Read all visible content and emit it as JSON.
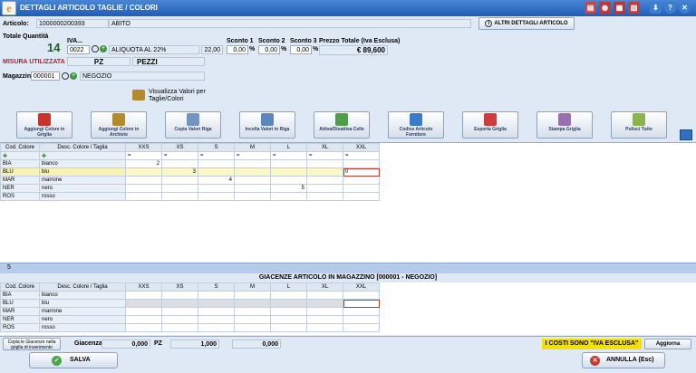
{
  "window": {
    "title": "DETTAGLI ARTICOLO TAGLIE / COLORI",
    "app_icon": "e",
    "controls": [
      "pdf-icon",
      "camera-icon",
      "calendar-icon",
      "calculator-icon",
      "download-icon",
      "help-icon",
      "close-icon"
    ]
  },
  "articolo": {
    "label": "Articolo:",
    "code": "1000000200393",
    "desc": "ABITO",
    "more_details": "ALTRI DETTAGLI ARTICOLO"
  },
  "quantita": {
    "label": "Totale Quantità",
    "value": "14"
  },
  "iva": {
    "label": "IVA...",
    "code": "0022",
    "desc": "ALIQUOTA AL 22%",
    "rate": "22,00"
  },
  "sconti": [
    {
      "label": "Sconto 1",
      "value": "0,00",
      "pct": "%"
    },
    {
      "label": "Sconto 2",
      "value": "0,00",
      "pct": "%"
    },
    {
      "label": "Sconto 3",
      "value": "0,00",
      "pct": "%"
    }
  ],
  "prezzo": {
    "label": "Prezzo Totale (Iva Esclusa)",
    "value": "€ 89,600"
  },
  "misura": {
    "label": "MISURA UTILIZZATA :",
    "code": "PZ",
    "desc": "PEZZI"
  },
  "magazzino": {
    "label": "Magazzino",
    "code": "000001",
    "desc": "NEGOZIO"
  },
  "visualizza": "Visualizza Valori per Taglie/Colori",
  "toolbar": [
    {
      "name": "aggiungi-colore-griglia",
      "label": "Aggiungi Colore in Griglia",
      "icon": "#c9332b"
    },
    {
      "name": "aggiungi-colore-archivio",
      "label": "Aggiungi Colore in Archivio",
      "icon": "#b58a2c"
    },
    {
      "name": "copia-valori-riga",
      "label": "Copia Valori Riga",
      "icon": "#6f95c4"
    },
    {
      "name": "incolla-valori-riga",
      "label": "Incolla Valori in Riga",
      "icon": "#5d86bd"
    },
    {
      "name": "attiva-disattiva-celle",
      "label": "Attiva/Disattiva Celle",
      "icon": "#4e9e4a"
    },
    {
      "name": "codice-articolo-fornitore",
      "label": "Codice Articolo Fornitore",
      "icon": "#3a7bc8"
    },
    {
      "name": "esporta-griglia",
      "label": "Esporta Griglia",
      "icon": "#d03a3a"
    },
    {
      "name": "stampa-griglia",
      "label": "Stampa Griglia",
      "icon": "#9a6fb0"
    },
    {
      "name": "pulisci-tutto",
      "label": "Pulisci Tutto",
      "icon": "#8bb54a"
    }
  ],
  "grid": {
    "headers": [
      "Cod. Colore",
      "Desc. Colore / Taglia",
      "XXS",
      "XS",
      "S",
      "M",
      "L",
      "XL",
      "XXL"
    ],
    "filter_op": "=",
    "rows": [
      {
        "code": "BIA",
        "desc": "bianco",
        "values": [
          "2",
          "",
          "",
          "",
          "",
          "",
          ""
        ]
      },
      {
        "code": "BLU",
        "desc": "blu",
        "values": [
          "",
          "3",
          "",
          "",
          "",
          "",
          "0"
        ]
      },
      {
        "code": "MAR",
        "desc": "marrone",
        "values": [
          "",
          "",
          "4",
          "",
          "",
          "",
          ""
        ]
      },
      {
        "code": "NER",
        "desc": "nero",
        "values": [
          "",
          "",
          "",
          "",
          "5",
          "",
          ""
        ]
      },
      {
        "code": "ROS",
        "desc": "rosso",
        "values": [
          "",
          "",
          "",
          "",
          "",
          "",
          ""
        ]
      }
    ],
    "row_count": "5"
  },
  "giacenze": {
    "title": "GIACENZE ARTICOLO IN MAGAZZINO [000001 - NEGOZIO]",
    "rows": [
      {
        "code": "BIA",
        "desc": "bianco"
      },
      {
        "code": "BLU",
        "desc": "blu"
      },
      {
        "code": "MAR",
        "desc": "marrone"
      },
      {
        "code": "NER",
        "desc": "nero"
      },
      {
        "code": "ROS",
        "desc": "rosso"
      }
    ]
  },
  "bottom": {
    "copia_label": "Copia le Giacenze nella griglia di inserimento",
    "giacenza_label": "Giacenza:",
    "giacenza_value": "0,000",
    "unit": "PZ",
    "qty": "1,000",
    "other": "0,000",
    "iva_notice": "I COSTI SONO \"IVA ESCLUSA\"",
    "aggiorna": "Aggiorna"
  },
  "actions": {
    "save": "SALVA",
    "cancel": "ANNULLA (Esc)"
  }
}
